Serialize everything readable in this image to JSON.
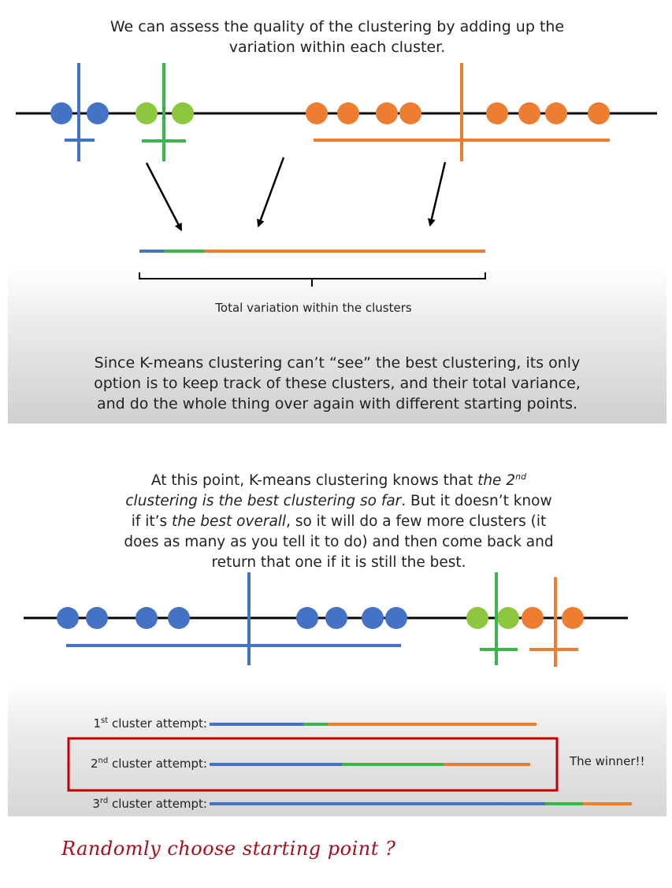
{
  "panel1": {
    "title": "We can assess the quality of the clustering by adding up the\nvariation within each cluster.",
    "total_label": "Total variation within the clusters",
    "bottom_text": "Since K-means clustering can’t “see” the best clustering, its only\noption is to keep track of these clusters, and their total variance,\nand do the whole thing over again with different starting points."
  },
  "panel2": {
    "para": {
      "l1a": "At this point, K-means clustering knows that ",
      "l1b": "the 2",
      "l1sup": "nd",
      "l2a": "clustering is the best clustering so far",
      "l2b": ". But it doesn’t know",
      "l3a": "if it’s ",
      "l3b": "the best overall",
      "l3c": ", so it will do a few more clusters (it",
      "l4": "does as many as you tell it to do) and then come back and",
      "l5": "return that one if it is still the best."
    },
    "attempts": [
      {
        "num": "1",
        "sup": "st",
        "suffix": " cluster attempt:"
      },
      {
        "num": "2",
        "sup": "nd",
        "suffix": " cluster attempt:"
      },
      {
        "num": "3",
        "sup": "rd",
        "suffix": " cluster attempt:"
      }
    ],
    "winner": "The winner!!"
  },
  "handwritten_note": "Randomly choose starting point ?",
  "colors": {
    "blue": "#4472c4",
    "green": "#39b54a",
    "light_green": "#8dc63f",
    "orange": "#ed7d31",
    "highlight_red": "#c00000"
  }
}
